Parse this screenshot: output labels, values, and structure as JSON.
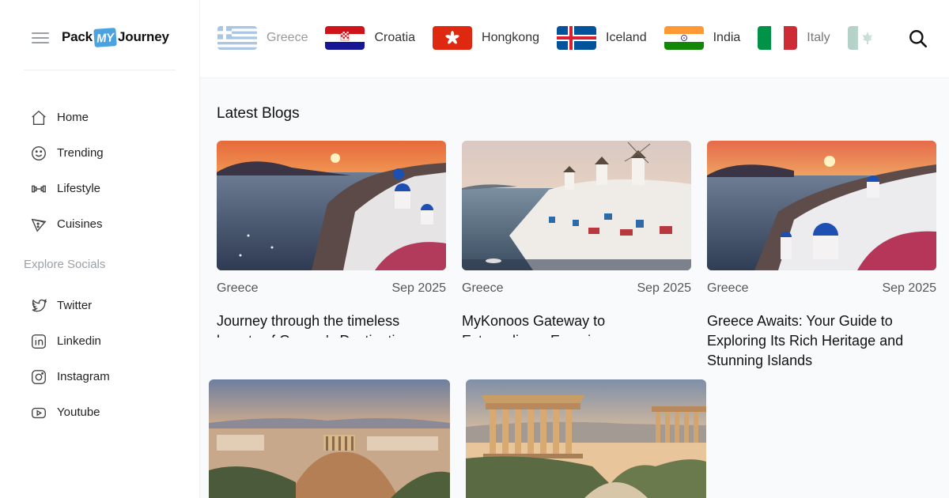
{
  "brand": {
    "pre": "Pack",
    "mid": "MY",
    "post": "Journey"
  },
  "sidebar": {
    "nav": [
      {
        "label": "Home",
        "icon": "home-icon"
      },
      {
        "label": "Trending",
        "icon": "smile-icon"
      },
      {
        "label": "Lifestyle",
        "icon": "dumbbell-icon"
      },
      {
        "label": "Cuisines",
        "icon": "pizza-icon"
      }
    ],
    "socials_heading": "Explore Socials",
    "socials": [
      {
        "label": "Twitter",
        "icon": "twitter-icon"
      },
      {
        "label": "Linkedin",
        "icon": "linkedin-icon"
      },
      {
        "label": "Instagram",
        "icon": "instagram-icon"
      },
      {
        "label": "Youtube",
        "icon": "youtube-icon"
      }
    ]
  },
  "countries": [
    {
      "label": "Greece",
      "flag": "greece-flag-icon"
    },
    {
      "label": "Croatia",
      "flag": "croatia-flag-icon"
    },
    {
      "label": "Hongkong",
      "flag": "hongkong-flag-icon"
    },
    {
      "label": "Iceland",
      "flag": "iceland-flag-icon"
    },
    {
      "label": "India",
      "flag": "india-flag-icon"
    },
    {
      "label": "Italy",
      "flag": "italy-flag-icon"
    },
    {
      "label": "",
      "flag": "canada-flag-icon"
    }
  ],
  "main": {
    "section_title": "Latest Blogs",
    "blogs": [
      {
        "category": "Greece",
        "date": "Sep 2025",
        "title": "Journey through the timeless beauty of Greece's Destinations"
      },
      {
        "category": "Greece",
        "date": "Sep 2025",
        "title": "MyKonoos Gateway to Extraordinary Experiences"
      },
      {
        "category": "Greece",
        "date": "Sep 2025",
        "title": "Greece Awaits: Your Guide to Exploring Its Rich Heritage and Stunning Islands"
      }
    ]
  },
  "colors": {
    "accent": "#4aa3df",
    "muted": "#9aa0a6"
  }
}
